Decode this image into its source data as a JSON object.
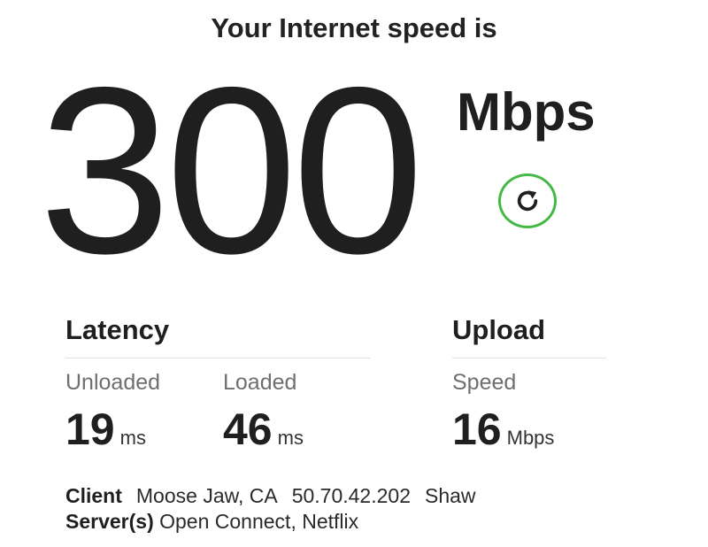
{
  "headline": "Your Internet speed is",
  "speed": {
    "value": "300",
    "unit": "Mbps"
  },
  "refresh": {
    "icon": "refresh-icon",
    "accent_color": "#45b945"
  },
  "latency": {
    "title": "Latency",
    "unloaded": {
      "label": "Unloaded",
      "value": "19",
      "unit": "ms"
    },
    "loaded": {
      "label": "Loaded",
      "value": "46",
      "unit": "ms"
    }
  },
  "upload": {
    "title": "Upload",
    "speed": {
      "label": "Speed",
      "value": "16",
      "unit": "Mbps"
    }
  },
  "client": {
    "label": "Client",
    "location": "Moose Jaw, CA",
    "ip": "50.70.42.202",
    "isp": "Shaw"
  },
  "servers": {
    "label": "Server(s)",
    "value": "Open Connect, Netflix"
  }
}
